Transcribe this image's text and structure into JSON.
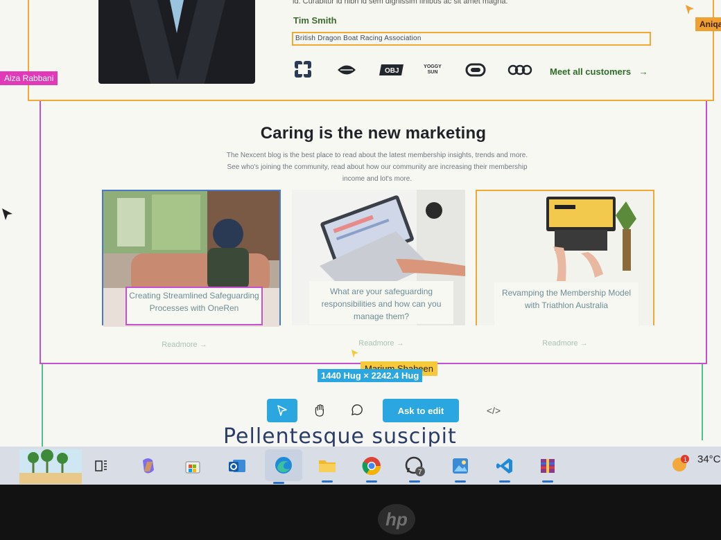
{
  "testimonial": {
    "quote_tail": "id. Curabitur id nibh id sem dignissim finibus ac sit amet magna.",
    "author_name": "Tim Smith",
    "author_org": "British Dragon Boat Racing Association"
  },
  "customer_logos": {
    "items": [
      "hexagon-logo",
      "lips-logo",
      "block-logo",
      "yogi-sun-logo",
      "stadium-logo",
      "chain-logo"
    ],
    "block_logo_text": "OBJ",
    "yogi_logo_text": "YOGGY SUN",
    "meet_all_label": "Meet all customers",
    "arrow": "→"
  },
  "collaborators": {
    "left": "Aiza Rabbani",
    "right": "Aniqa",
    "bottom": "Marium Shaheen"
  },
  "blog": {
    "title": "Caring is the new marketing",
    "description": "The Nexcent blog is the best place to read about the latest membership insights, trends and more. See who's joining the community, read about how our community are increasing their membership income and lot's more.",
    "cards": [
      {
        "caption": "Creating Streamlined Safeguarding Processes with OneRen",
        "readmore": "Readmore →"
      },
      {
        "caption": "What are your safeguarding responsibilities and how can you manage them?",
        "readmore": "Readmore →"
      },
      {
        "caption": "Revamping the Membership Model with Triathlon Australia",
        "readmore": "Readmore →"
      }
    ]
  },
  "size_badge": "1440 Hug × 2242.4 Hug",
  "toolbar": {
    "ask_to_edit": "Ask to edit",
    "code_label": "</>"
  },
  "next_section_heading": "Pellentesque suscipit",
  "taskbar": {
    "apps": [
      "widgets-icon",
      "task-view-icon",
      "copilot-icon",
      "store-icon",
      "outlook-icon",
      "edge-icon",
      "file-explorer-icon",
      "chrome-icon",
      "whatsapp-icon",
      "photos-icon",
      "vscode-icon",
      "winrar-icon"
    ],
    "whatsapp_badge": "7",
    "weather_badge": "1",
    "temperature": "34°C"
  },
  "colors": {
    "accent_blue": "#2aa6e0",
    "selection_orange": "#f0a830",
    "selection_magenta": "#c44fd0",
    "link_green": "#2f6b2a"
  }
}
